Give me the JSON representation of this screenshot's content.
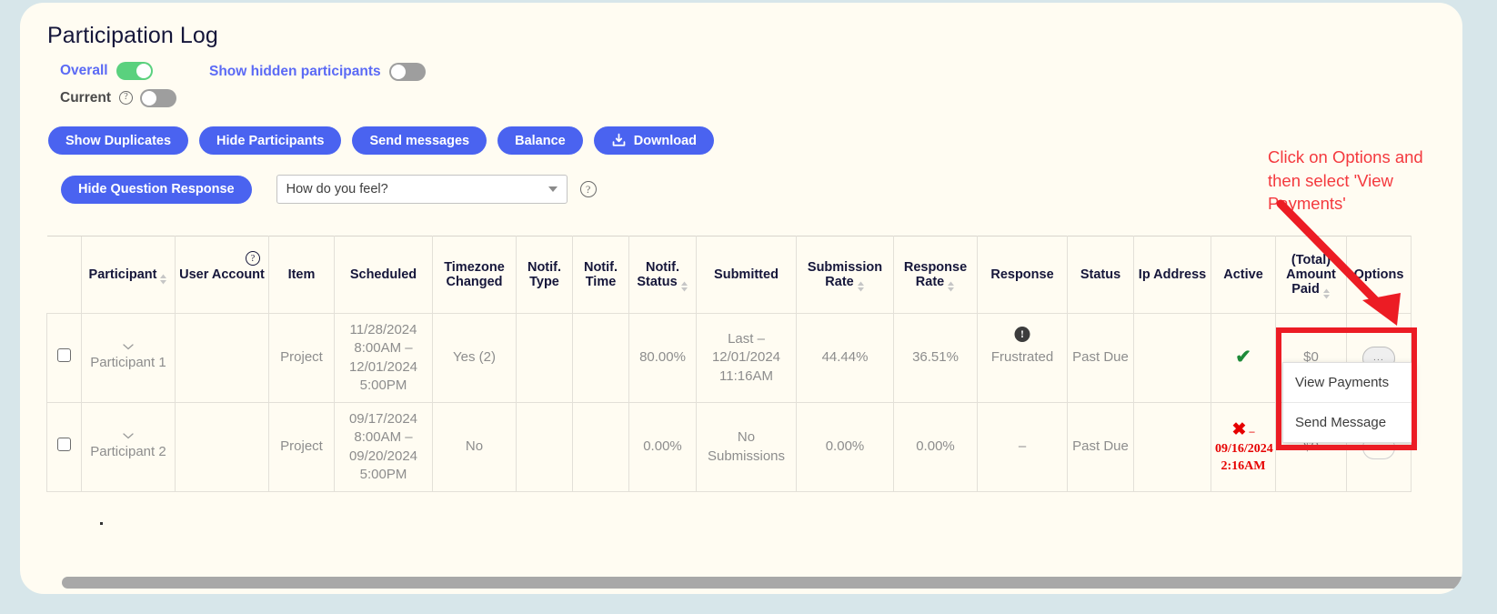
{
  "page": {
    "title": "Participation Log"
  },
  "toggles": {
    "overall": {
      "label": "Overall",
      "state": "on"
    },
    "current": {
      "label": "Current",
      "state": "off",
      "help_icon": "question-mark-icon",
      "help_glyph": "?"
    },
    "show_hidden": {
      "label": "Show hidden participants",
      "state": "off"
    }
  },
  "actions": {
    "show_duplicates": "Show Duplicates",
    "hide_participants": "Hide Participants",
    "send_messages": "Send messages",
    "balance": "Balance",
    "download": "Download",
    "hide_question_response": "Hide Question Response"
  },
  "question_select": {
    "value": "How do you feel?",
    "caret_icon": "chevron-down-icon",
    "help_glyph": "?"
  },
  "table": {
    "columns": [
      {
        "label": "",
        "key": "checkbox",
        "sortable": false
      },
      {
        "label": "Participant",
        "key": "participant",
        "sortable": true
      },
      {
        "label": "User Account",
        "key": "user_account",
        "sortable": false,
        "help_glyph": "?"
      },
      {
        "label": "Item",
        "key": "item",
        "sortable": false
      },
      {
        "label": "Scheduled",
        "key": "scheduled",
        "sortable": false
      },
      {
        "label": "Timezone Changed",
        "key": "timezone_changed",
        "sortable": false
      },
      {
        "label": "Notif. Type",
        "key": "notif_type",
        "sortable": false
      },
      {
        "label": "Notif. Time",
        "key": "notif_time",
        "sortable": false
      },
      {
        "label": "Notif. Status",
        "key": "notif_status",
        "sortable": true
      },
      {
        "label": "Submitted",
        "key": "submitted",
        "sortable": false
      },
      {
        "label": "Submission Rate",
        "key": "submission_rate",
        "sortable": true
      },
      {
        "label": "Response Rate",
        "key": "response_rate",
        "sortable": true
      },
      {
        "label": "Response",
        "key": "response",
        "sortable": false
      },
      {
        "label": "Status",
        "key": "status",
        "sortable": false
      },
      {
        "label": "Ip Address",
        "key": "ip_address",
        "sortable": false
      },
      {
        "label": "Active",
        "key": "active",
        "sortable": false
      },
      {
        "label": "(Total) Amount Paid",
        "key": "amount_paid",
        "sortable": true
      },
      {
        "label": "Options",
        "key": "options",
        "sortable": false
      }
    ],
    "rows": [
      {
        "participant": "Participant 1",
        "user_account": "",
        "item": "Project",
        "scheduled": "11/28/2024 8:00AM – 12/01/2024 5:00PM",
        "timezone_changed": "Yes (2)",
        "notif_type": "",
        "notif_time": "",
        "notif_status": "80.00%",
        "submitted": "Last – 12/01/2024 11:16AM",
        "submission_rate": "44.44%",
        "response_rate": "36.51%",
        "response": "Frustrated",
        "response_badge": "!",
        "status": "Past Due",
        "ip_address": "",
        "active": "check",
        "active_date": "",
        "amount_paid": "$0",
        "options": "..."
      },
      {
        "participant": "Participant 2",
        "user_account": "",
        "item": "Project",
        "scheduled": "09/17/2024 8:00AM – 09/20/2024 5:00PM",
        "timezone_changed": "No",
        "notif_type": "",
        "notif_time": "",
        "notif_status": "0.00%",
        "submitted": "No Submissions",
        "submission_rate": "0.00%",
        "response_rate": "0.00%",
        "response": "–",
        "response_badge": "",
        "status": "Past Due",
        "ip_address": "",
        "active": "cross",
        "active_date": "09/16/2024 2:16AM",
        "amount_paid": "$0",
        "options": "..."
      }
    ]
  },
  "options_menu": {
    "items": [
      "View Payments",
      "Send Message"
    ]
  },
  "annotation": {
    "text": "Click on Options and then select 'View Payments'",
    "color": "#f4393e"
  },
  "colors": {
    "accent_blue": "#4a63f0",
    "toggle_on": "#5ad17e",
    "card_bg": "#fffcf2",
    "page_bg": "#d7e6ea",
    "annotation_red": "#ec1c24"
  }
}
